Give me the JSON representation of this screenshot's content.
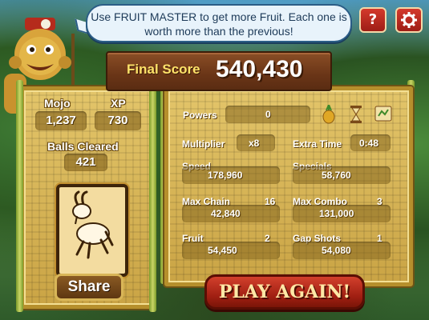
{
  "tip": "Use FRUIT MASTER to get more Fruit. Each one is worth more than the previous!",
  "top_buttons": {
    "help": "?",
    "settings_icon": "gear-icon"
  },
  "final_score": {
    "label": "Final Score",
    "value": "540,430"
  },
  "left": {
    "mojo_label": "Mojo",
    "mojo_value": "1,237",
    "xp_label": "XP",
    "xp_value": "730",
    "balls_label": "Balls Cleared",
    "balls_value": "421",
    "card_icon": "goat-icon",
    "share_label": "Share"
  },
  "right": {
    "powers_label": "Powers",
    "powers_value": "0",
    "multiplier_label": "Multiplier",
    "multiplier_value": "x8",
    "extra_time_label": "Extra Time",
    "extra_time_value": "0:48",
    "speed_label": "Speed",
    "speed_value": "178,960",
    "specials_label": "Specials",
    "specials_value": "58,760",
    "max_chain_label": "Max Chain",
    "max_chain_count": "16",
    "max_chain_value": "42,840",
    "max_combo_label": "Max Combo",
    "max_combo_count": "3",
    "max_combo_value": "131,000",
    "fruit_label": "Fruit",
    "fruit_count": "2",
    "fruit_value": "54,450",
    "gap_shots_label": "Gap Shots",
    "gap_shots_count": "1",
    "gap_shots_value": "54,080"
  },
  "play_again": "PLAY AGAIN!",
  "colors": {
    "accent_red": "#c22b1c",
    "wood": "#6a3517",
    "panel": "#d8b655",
    "score_label": "#ffe36a"
  }
}
